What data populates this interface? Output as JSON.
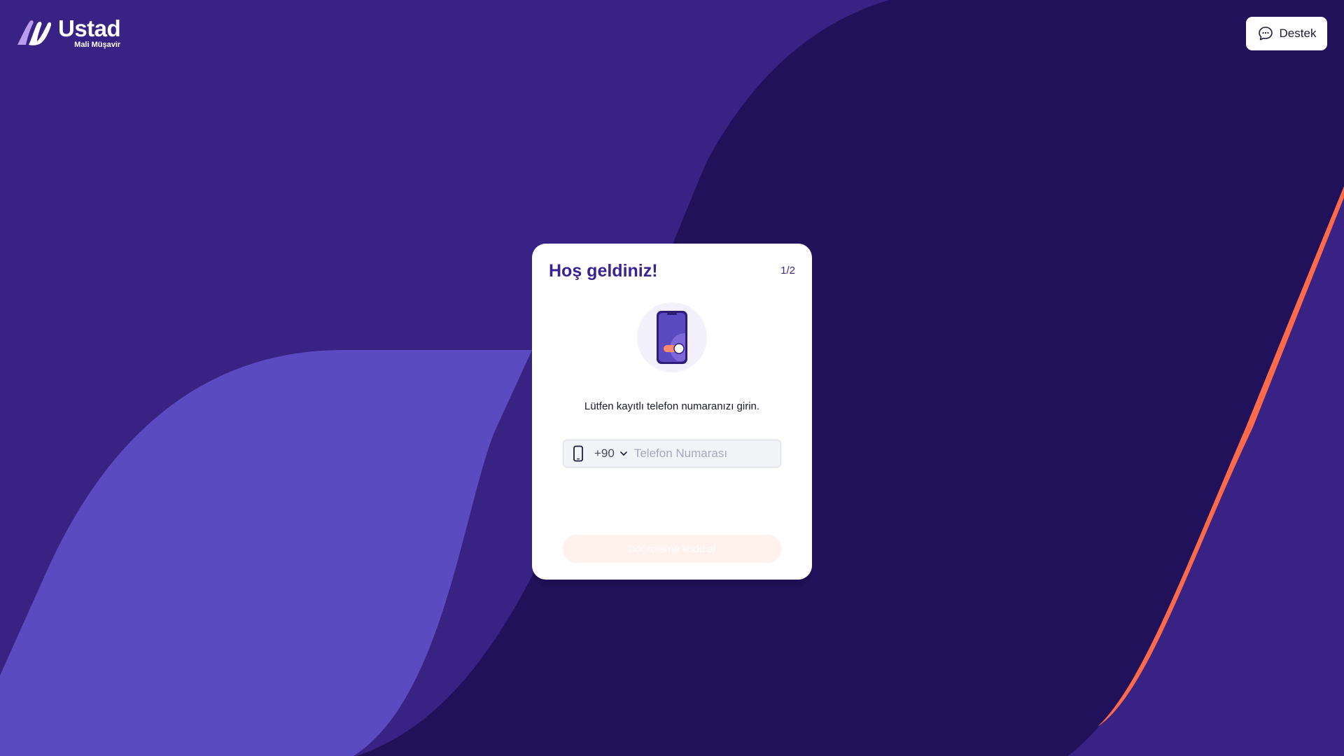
{
  "brand": {
    "name": "Ustad",
    "subtitle": "Mali Müşavir",
    "logo_icon": "ustad-logo-mark"
  },
  "header": {
    "support_label": "Destek",
    "support_icon": "chat-bubble-icon"
  },
  "card": {
    "title": "Hoş geldiniz!",
    "step": "1/2",
    "illustration_icon": "phone-toggle-icon",
    "instruction": "Lütfen kayıtlı telefon numaranızı girin.",
    "phone": {
      "icon": "phone-icon",
      "country_code": "+90",
      "placeholder": "Telefon Numarası",
      "value": ""
    },
    "submit_label": "Doğrulama kodu al",
    "submit_disabled": true
  },
  "colors": {
    "background": "#382384",
    "dark_wave": "#21105a",
    "light_wave": "#5c4ac0",
    "accent_stripe": "#ff6b4a",
    "brand_primary": "#3a2390",
    "button_disabled": "#fff1ec"
  }
}
